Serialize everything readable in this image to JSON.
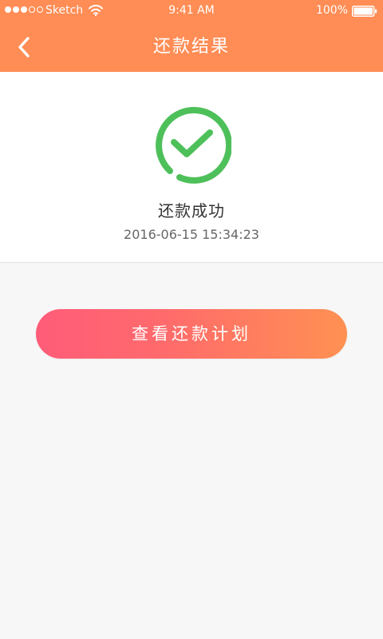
{
  "status_bar": {
    "carrier": "Sketch",
    "time": "9:41 AM",
    "battery": "100%"
  },
  "nav": {
    "title": "还款结果",
    "back_icon": "chevron-left-icon"
  },
  "result": {
    "icon": "check-circle-icon",
    "title": "还款成功",
    "timestamp": "2016-06-15 15:34:23"
  },
  "actions": {
    "view_plan_label": "查看还款计划"
  },
  "colors": {
    "header": "#ff8d55",
    "success": "#4ec05a",
    "button_start": "#ff5c79",
    "button_end": "#ff9152",
    "background": "#f7f7f7"
  }
}
